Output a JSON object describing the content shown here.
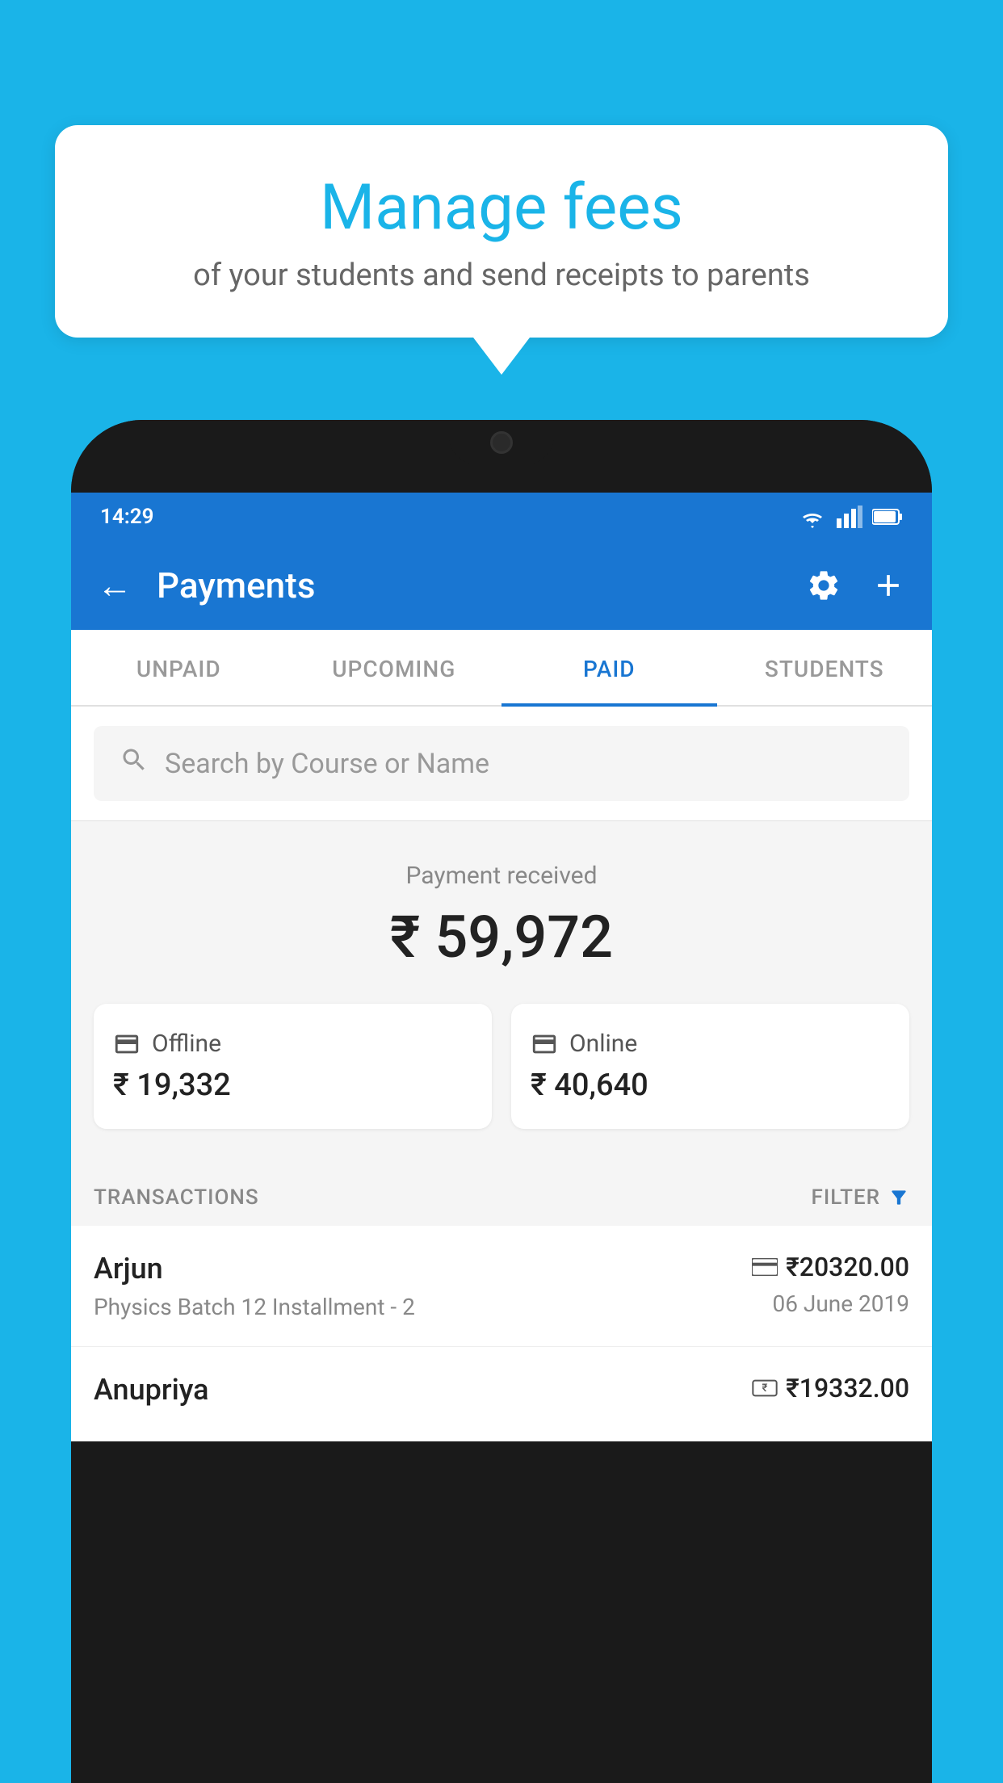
{
  "background_color": "#1ab4e8",
  "tooltip": {
    "title": "Manage fees",
    "subtitle": "of your students and send receipts to parents"
  },
  "phone": {
    "status_bar": {
      "time": "14:29",
      "icons": [
        "wifi",
        "signal",
        "battery"
      ]
    },
    "app_bar": {
      "title": "Payments",
      "back_label": "←",
      "settings_label": "⚙",
      "add_label": "+"
    },
    "tabs": [
      {
        "label": "UNPAID",
        "active": false
      },
      {
        "label": "UPCOMING",
        "active": false
      },
      {
        "label": "PAID",
        "active": true
      },
      {
        "label": "STUDENTS",
        "active": false
      }
    ],
    "search": {
      "placeholder": "Search by Course or Name"
    },
    "payment_summary": {
      "label": "Payment received",
      "amount": "₹ 59,972",
      "offline": {
        "type": "Offline",
        "amount": "₹ 19,332"
      },
      "online": {
        "type": "Online",
        "amount": "₹ 40,640"
      }
    },
    "transactions": {
      "section_label": "TRANSACTIONS",
      "filter_label": "FILTER",
      "items": [
        {
          "name": "Arjun",
          "detail": "Physics Batch 12 Installment - 2",
          "amount": "₹20320.00",
          "date": "06 June 2019",
          "payment_type": "card"
        },
        {
          "name": "Anupriya",
          "detail": "",
          "amount": "₹19332.00",
          "date": "",
          "payment_type": "offline"
        }
      ]
    }
  }
}
